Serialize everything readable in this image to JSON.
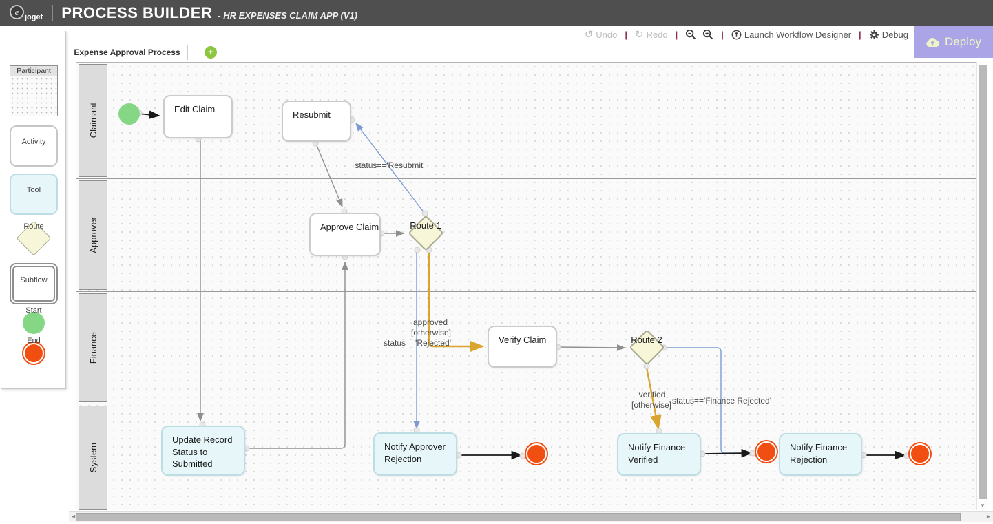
{
  "header": {
    "logo_glyph": "e",
    "logo_text": "joget",
    "title": "PROCESS BUILDER",
    "subtitle": "- HR EXPENSES CLAIM APP (V1)"
  },
  "toolbar": {
    "undo_label": "Undo",
    "redo_label": "Redo",
    "separator": "|",
    "launch_label": "Launch Workflow Designer",
    "debug_label": "Debug",
    "deploy_label": "Deploy"
  },
  "tabs": {
    "active_tab": "Expense Approval Process",
    "add_button": "+"
  },
  "palette": {
    "items": [
      "Participant",
      "Activity",
      "Tool",
      "Route",
      "Subflow",
      "Start",
      "End"
    ]
  },
  "diagram": {
    "lanes": [
      "Claimant",
      "Approver",
      "Finance",
      "System"
    ],
    "nodes": {
      "edit_claim": "Edit Claim",
      "resubmit": "Resubmit",
      "approve_claim": "Approve Claim",
      "route1": "Route 1",
      "verify_claim": "Verify Claim",
      "route2": "Route 2",
      "update_record": "Update Record\nStatus to\nSubmitted",
      "notify_approver_rejection": "Notify Approver\nRejection",
      "notify_finance_verified": "Notify Finance\nVerified",
      "notify_finance_rejection": "Notify Finance\nRejection"
    },
    "edge_labels": {
      "resubmit_cond": "status=='Resubmit'",
      "approved": "approved",
      "otherwise1": "[otherwise]",
      "rejected_cond": "status=='Rejected'",
      "verified": "verified",
      "otherwise2": "[otherwise]",
      "finance_rejected_cond": "status=='Finance Rejected'"
    }
  },
  "scrollbars": {
    "down_arrow": "▼",
    "left_arrow": "◄",
    "right_arrow": "►"
  },
  "colors": {
    "header_bg": "#4f4f4f",
    "deploy_bg": "#aba4e7",
    "deploy_text": "#edf4c6",
    "add_button_green": "#8dc63f",
    "start_green": "#85d685",
    "end_red": "#f14e12",
    "edge_gray": "#8f8f8f",
    "edge_blue": "#7d9bd2",
    "edge_orange": "#d9a52e",
    "edge_black": "#1a1a1a",
    "lane_header_bg": "#dcdcdc",
    "tool_node_fill": "#e6f6f9",
    "route_fill": "#f8f6d8",
    "separator_maroon": "#8d3156"
  }
}
